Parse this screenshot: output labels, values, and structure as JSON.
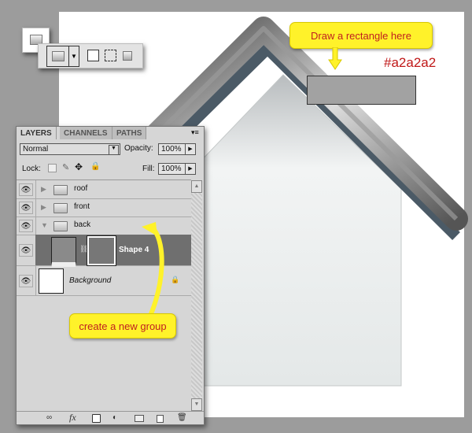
{
  "annotations": {
    "draw_rectangle": "Draw a rectangle here",
    "color_code": "#a2a2a2",
    "create_group": "create a new group"
  },
  "colors": {
    "rectangle": "#a2a2a2",
    "callout": "#fff22a",
    "callout_text": "#c02020"
  },
  "toolbar": {
    "tool": "rectangle-tool",
    "modes": [
      "shape-layers",
      "paths",
      "fill-pixels"
    ]
  },
  "layers_panel": {
    "tabs": [
      "LAYERS",
      "CHANNELS",
      "PATHS"
    ],
    "blend_mode": "Normal",
    "opacity_label": "Opacity:",
    "opacity": "100%",
    "lock_label": "Lock:",
    "fill_label": "Fill:",
    "fill": "100%",
    "layers": [
      {
        "name": "roof",
        "type": "group",
        "expanded": false
      },
      {
        "name": "front",
        "type": "group",
        "expanded": false
      },
      {
        "name": "back",
        "type": "group",
        "expanded": true
      },
      {
        "name": "Shape 4",
        "type": "shape",
        "selected": true
      },
      {
        "name": "Background",
        "type": "background",
        "locked": true
      }
    ],
    "footer_icons": [
      "link-icon",
      "fx-icon",
      "mask-icon",
      "adjustment-icon",
      "folder-icon",
      "new-layer-icon",
      "trash-icon"
    ]
  }
}
